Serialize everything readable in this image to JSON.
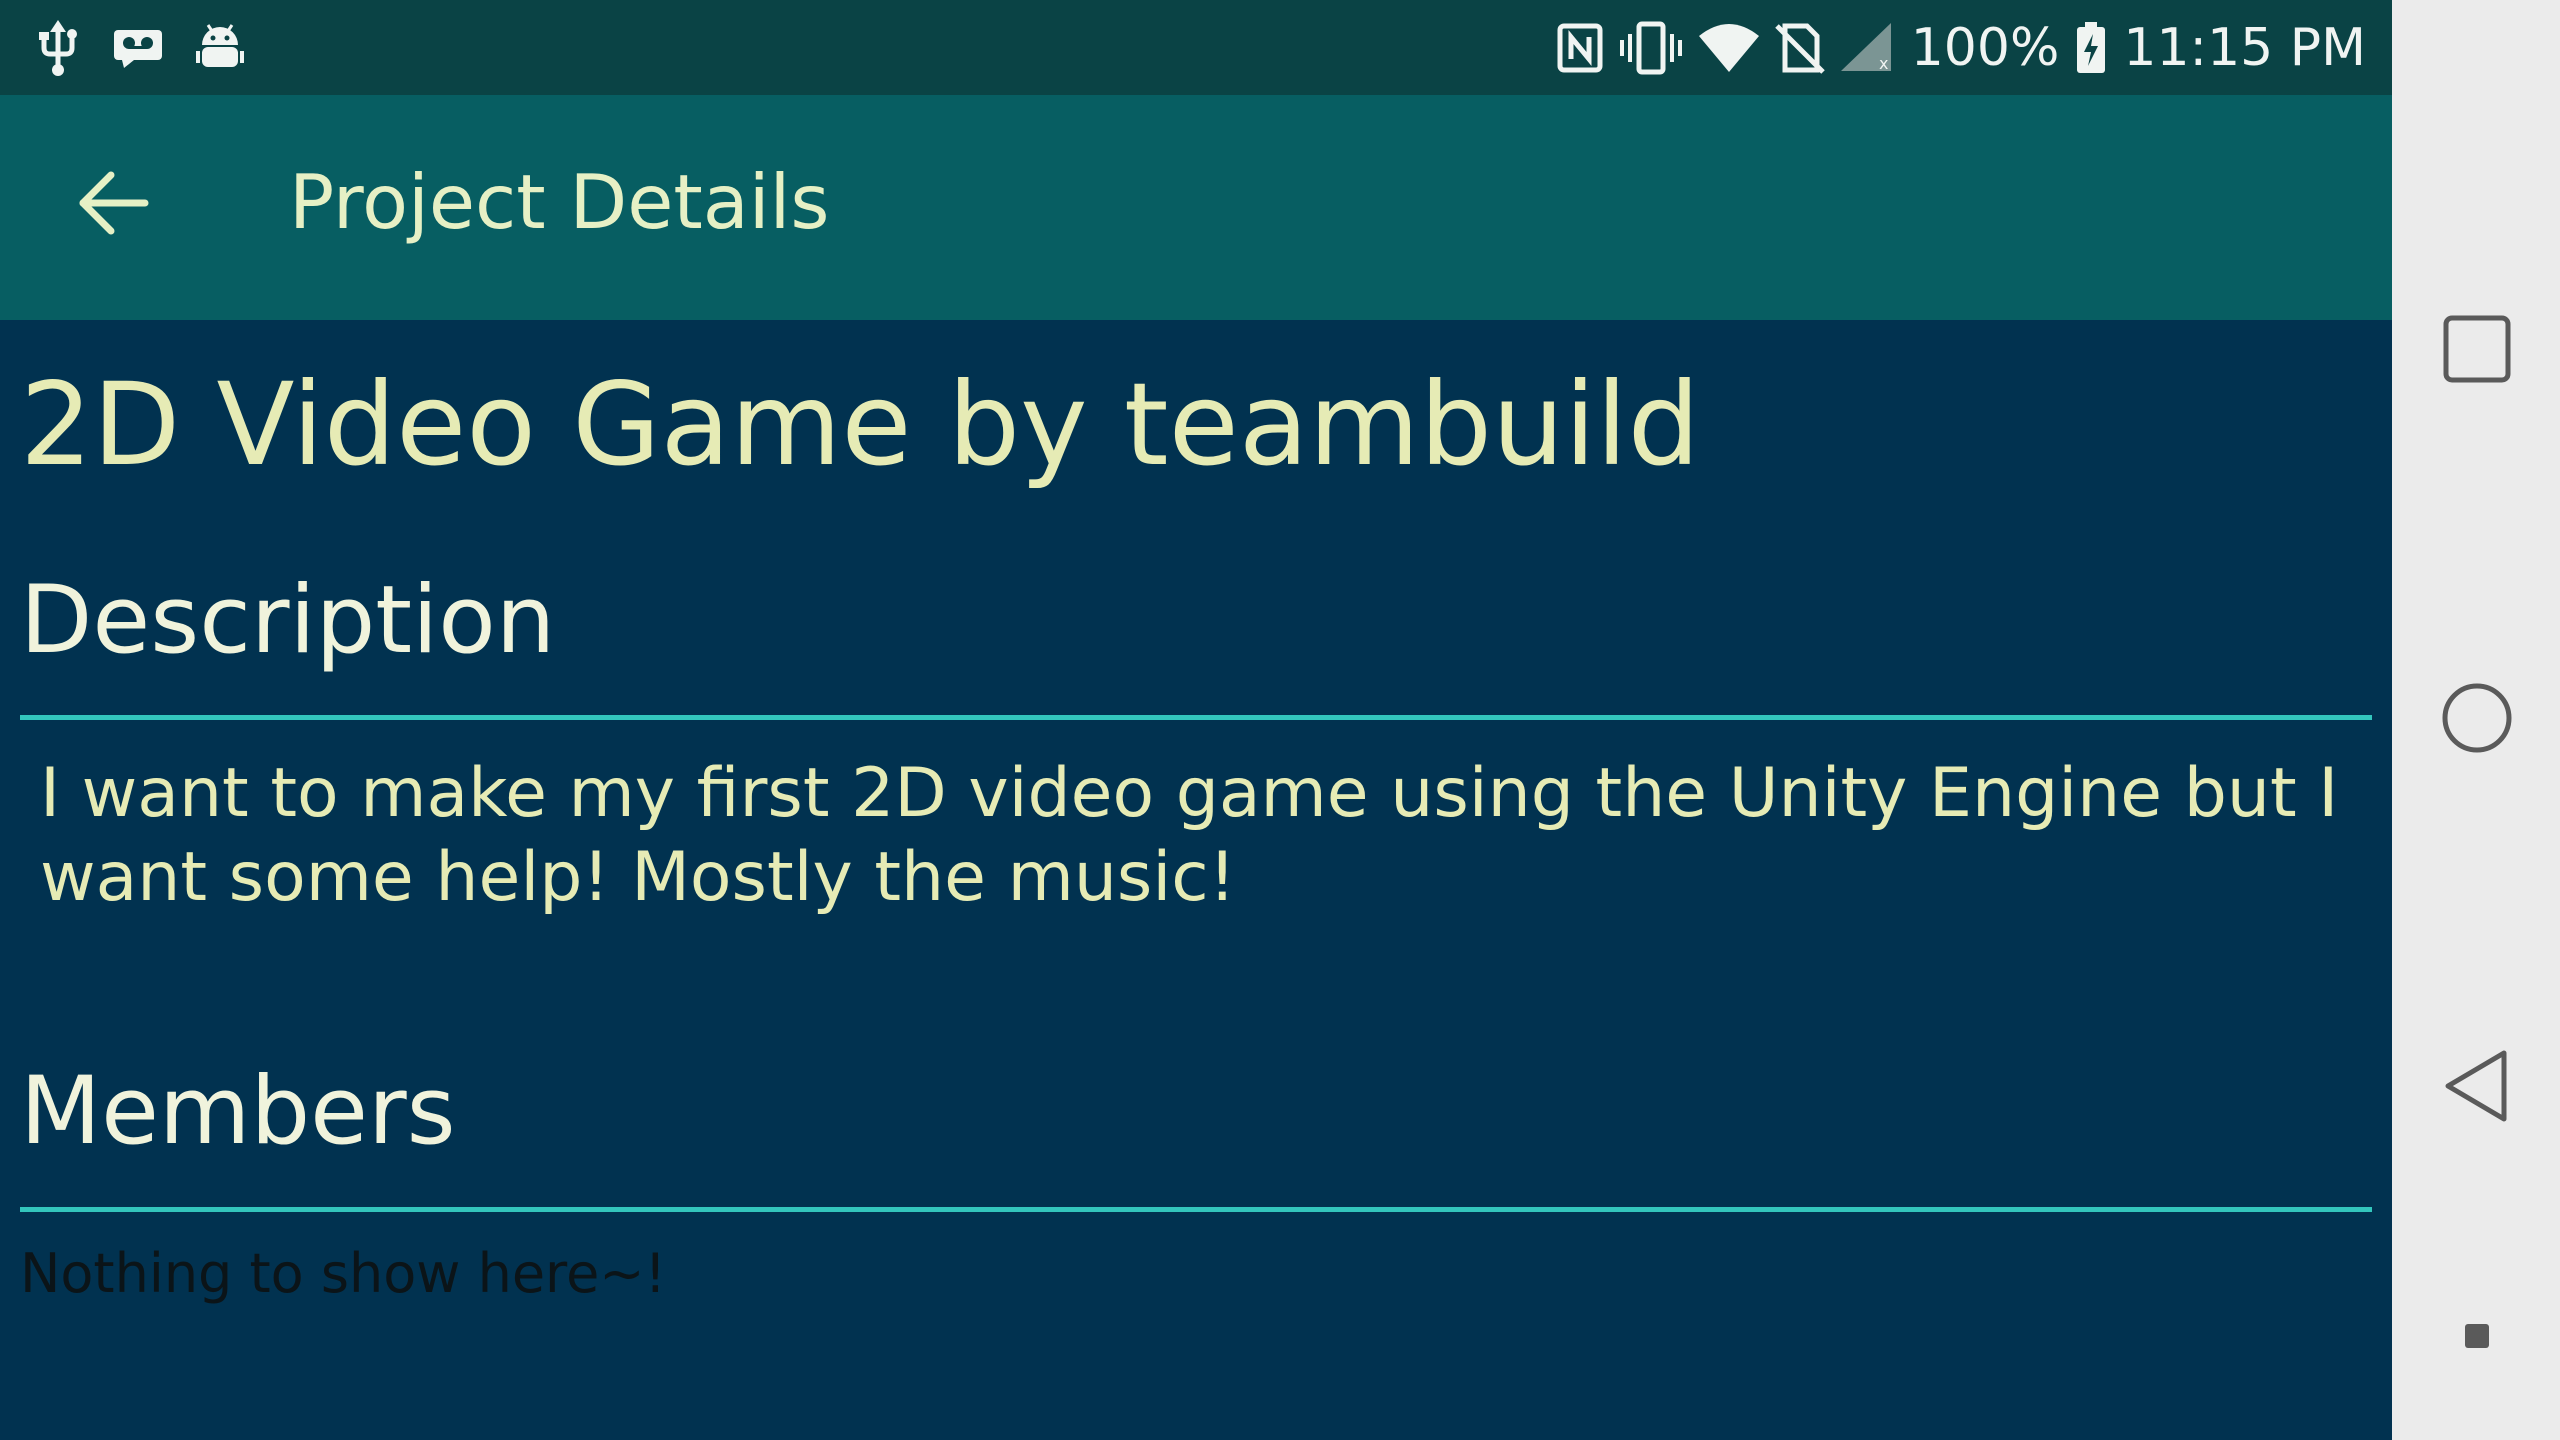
{
  "status_bar": {
    "battery_percent": "100%",
    "time": "11:15 PM",
    "left_icons": [
      "usb-icon",
      "voicemail-icon",
      "android-debug-icon"
    ],
    "right_icons": [
      "nfc-icon",
      "vibrate-icon",
      "wifi-icon",
      "no-sim-icon",
      "signal-icon",
      "battery-charging-icon"
    ]
  },
  "app_bar": {
    "title": "Project Details",
    "back_icon": "arrow-back-icon"
  },
  "project": {
    "title": "2D Video Game by teambuild",
    "description_header": "Description",
    "description": "I want to make my first 2D video game using the Unity Engine but I want some help! Mostly the music!",
    "members_header": "Members",
    "members_empty": "Nothing to show here~!"
  },
  "nav_bar": {
    "buttons": [
      "recents-icon",
      "home-icon",
      "back-icon",
      "keyboard-indicator-icon"
    ]
  },
  "colors": {
    "status_bar_bg": "#0a4345",
    "app_bar_bg": "#075e62",
    "content_bg": "#013250",
    "accent": "#33c6bd",
    "text_primary": "#e6ebb5",
    "nav_bar_bg": "#ebebeb"
  }
}
